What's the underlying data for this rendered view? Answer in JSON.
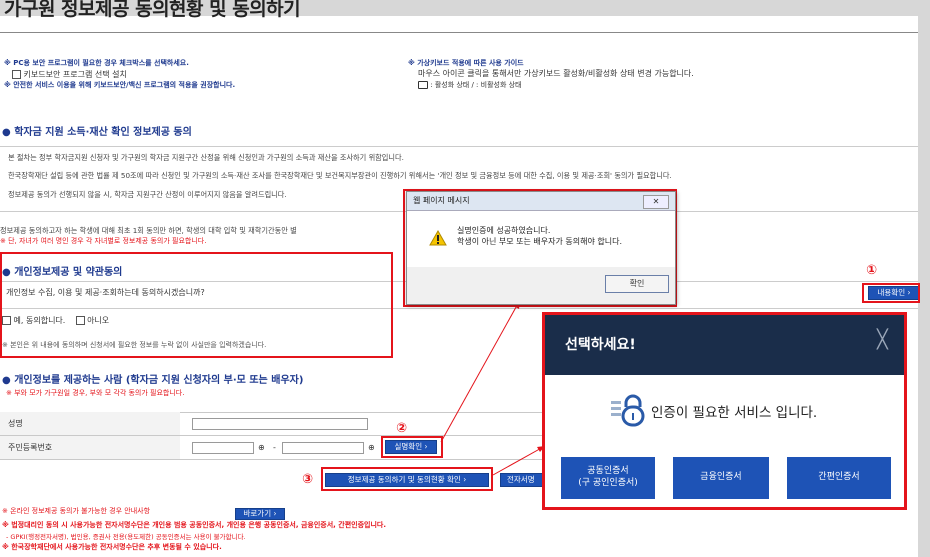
{
  "page": {
    "title": "가구원 정보제공 동의현황 및 동의하기"
  },
  "security": {
    "notice1": "※ PC용 보안 프로그램이 필요한 경우 체크박스를 선택하세요.",
    "checkbox_label": "키보드보안 프로그램 선택 설치",
    "notice2": "※ 안전한 서비스 이용을 위해 키보드보안/백신 프로그램의 적용을 권장합니다.",
    "vkbd_title": "※ 가상키보드 적용에 따른 사용 가이드",
    "vkbd_desc": "마우스 아이콘 클릭을 통해서만 가상키보드 활성화/비활성화 상태 변경 가능합니다.",
    "vkbd_status": ": 활성화 상태 / : 비활성화 상태"
  },
  "section1": {
    "heading": "학자금 지원 소득·재산 확인 정보제공 동의",
    "lines": [
      "본 절차는 정부 학자금지원 신청자 및 가구원의 학자금 지원구간 산정을 위해 신청인과 가구원의 소득과 재산을 조사하기 위함입니다.",
      "한국장학재단 설립 등에 관한 법률 제 50조에 따라 신청인 및 가구원의 소득·재산 조사를 한국장학재단 및 보건복지부장관이 진행하기 위해서는 '개인 정보 및 금융정보 등에 대한 수집, 이용 및 제공·조회' 동의가 필요합니다.",
      "정보제공 동의가 선행되지 않을 시, 학자금 지원구간 산정이 이루어지지 않음을 알려드립니다."
    ],
    "note1": "정보제공 동의하고자 하는 학생에 대해 최초 1회 동의만 하면, 학생의 대학 입학 및 재학기간동안 별",
    "note2": "※ 단, 자녀가 여러 명인 경우 각 자녀별로 정보제공 동의가 필요합니다."
  },
  "section2": {
    "heading": "개인정보제공 및 약관동의",
    "question": "개인정보 수집, 이용 및 제공·조회하는데 동의하시겠습니까?",
    "agree": "예, 동의합니다.",
    "disagree": "아니오",
    "confirm_note": "※ 본인은 위 내용에 동의하며 신청서에 필요한 정보를 누락 없이 사실만을 입력하겠습니다.",
    "content_button": "내용확인",
    "marker": "①"
  },
  "section3": {
    "heading": "개인정보를 제공하는 사람 (학자금 지원 신청자의 부·모 또는 배우자)",
    "subnote": "※ 부와 모가 가구원일 경우, 부와 모 각각 동의가 필요합니다.",
    "name_label": "성명",
    "rrn_label": "주민등록번호",
    "rrn_dash": "-",
    "verify_button": "실명확인",
    "marker2": "②",
    "submit_button": "정보제공 동의하기 및 동의현황 확인",
    "marker3": "③",
    "cert_button_partial": "전자서명"
  },
  "footer": {
    "offline_note": "※ 온라인 정보제공 동의가 불가능한 경우 안내사항",
    "goto_button": "바로가기",
    "line1": "※ 법정대리인 동의 시 사용가능한 전자서명수단은 개인용 범용 공동인증서, 개인용 은행 공동인증서, 금융인증서, 간편인증입니다.",
    "line2": "- GPKI(행정전자서명), 법인용, 증권사 전용(용도제한) 공동인증서는 사용이 불가합니다.",
    "line3": "※ 한국장학재단에서 사용가능한 전자서명수단은 추후 변동될 수 있습니다."
  },
  "alert": {
    "title": "웹 페이지 메시지",
    "message1": "실명인증에 성공하였습니다.",
    "message2": "학생이 아닌 부모 또는 배우자가 동의해야 합니다.",
    "ok": "확인",
    "close": "✕"
  },
  "modal": {
    "title": "선택하세요!",
    "close": "╳",
    "message": "인증이 필요한 서비스 입니다.",
    "buttons": [
      "공동인증서\n(구 공인인증서)",
      "금융인증서",
      "간편인증서"
    ]
  },
  "colors": {
    "accent_blue": "#1e53b6",
    "heading_blue": "#1f3a8f",
    "marker_red": "#e4141b",
    "modal_header": "#1a2d4a"
  }
}
